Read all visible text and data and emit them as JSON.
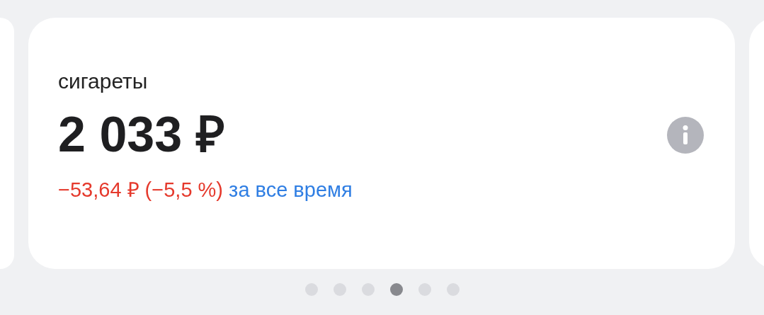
{
  "card": {
    "title": "сигареты",
    "amount": "2 033 ₽",
    "change": "−53,64 ₽ (−5,5 %)",
    "period": "за все время"
  },
  "pager": [
    {
      "selected": false
    },
    {
      "selected": false
    },
    {
      "selected": false
    },
    {
      "selected": true
    },
    {
      "selected": false
    },
    {
      "selected": false
    }
  ]
}
